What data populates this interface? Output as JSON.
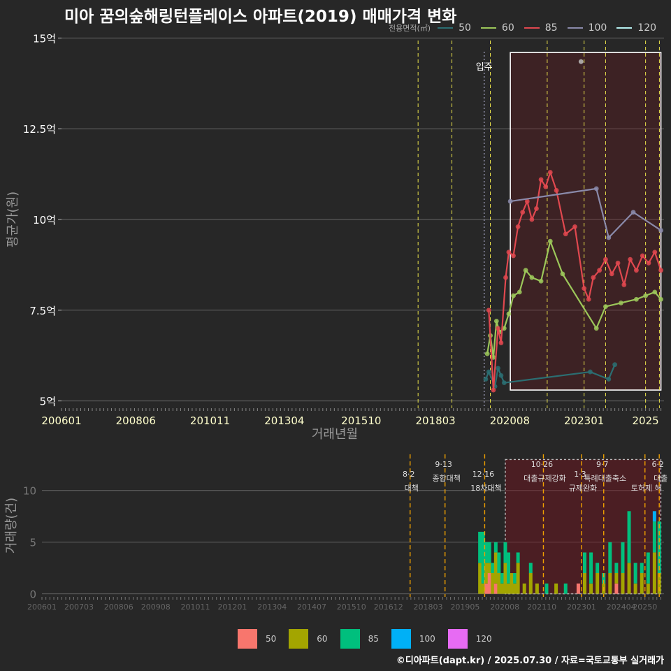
{
  "title": "미아 꿈의숲해링턴플레이스 아파트(2019) 매매가격 변화",
  "credit": "©디아파트(dapt.kr) / 2025.07.30 / 자료=국토교통부 실거래가",
  "legend_top": {
    "title": "전용면적(㎡)",
    "items": [
      {
        "label": "50",
        "color": "#2b6e72"
      },
      {
        "label": "60",
        "color": "#9cc75a"
      },
      {
        "label": "85",
        "color": "#e0484f"
      },
      {
        "label": "100",
        "color": "#8a8aaa"
      },
      {
        "label": "120",
        "color": "#b6f0f0"
      }
    ]
  },
  "legend_bottom": {
    "items": [
      {
        "label": "50",
        "color": "#f8766d"
      },
      {
        "label": "60",
        "color": "#a3a500"
      },
      {
        "label": "85",
        "color": "#00bf7d"
      },
      {
        "label": "100",
        "color": "#00b0f6"
      },
      {
        "label": "120",
        "color": "#e76bf3"
      }
    ]
  },
  "chart_data": [
    {
      "type": "line",
      "ylabel": "평균가(원)",
      "xlabel": "거래년월",
      "x_ticks": [
        "200601",
        "200806",
        "201011",
        "201304",
        "201510",
        "201803",
        "202008",
        "202301",
        "2025"
      ],
      "y_ticks": [
        "5억",
        "7.5억",
        "10억",
        "12.5억",
        "15억"
      ],
      "y_tick_values": [
        5,
        7.5,
        10,
        12.5,
        15
      ],
      "ylim": [
        4.8,
        15.2
      ],
      "xlim": [
        2006.0,
        2025.6
      ],
      "annotation": "입주",
      "move_in": 2019.75,
      "policy_lines": [
        2017.6,
        2018.7,
        2019.95,
        2021.8,
        2023.0,
        2023.7,
        2025.0,
        2025.45
      ],
      "highlight": {
        "x": [
          2020.6,
          2025.5
        ],
        "y": [
          5.3,
          14.6
        ]
      },
      "series": [
        {
          "name": "50",
          "color": "#2b6e72",
          "x": [
            2019.8,
            2019.9,
            2020.1,
            2020.2,
            2020.3,
            2020.4,
            2023.2,
            2023.8,
            2024.0
          ],
          "y": [
            5.6,
            5.8,
            5.4,
            5.9,
            5.7,
            5.5,
            5.8,
            5.6,
            6.0
          ]
        },
        {
          "name": "60",
          "color": "#9cc75a",
          "x": [
            2019.85,
            2019.95,
            2020.05,
            2020.15,
            2020.25,
            2020.4,
            2020.55,
            2020.7,
            2020.9,
            2021.1,
            2021.3,
            2021.6,
            2021.9,
            2022.3,
            2023.4,
            2023.7,
            2024.2,
            2024.7,
            2025.0,
            2025.3,
            2025.5
          ],
          "y": [
            6.3,
            6.8,
            6.2,
            7.2,
            6.9,
            7.0,
            7.4,
            7.9,
            8.0,
            8.6,
            8.4,
            8.3,
            9.4,
            8.5,
            7.0,
            7.6,
            7.7,
            7.8,
            7.9,
            8.0,
            7.8
          ]
        },
        {
          "name": "85",
          "color": "#e0484f",
          "x": [
            2019.9,
            2020.05,
            2020.2,
            2020.3,
            2020.45,
            2020.55,
            2020.7,
            2020.85,
            2021.0,
            2021.15,
            2021.3,
            2021.45,
            2021.6,
            2021.75,
            2021.9,
            2022.1,
            2022.4,
            2022.7,
            2023.0,
            2023.15,
            2023.3,
            2023.5,
            2023.7,
            2023.9,
            2024.1,
            2024.3,
            2024.5,
            2024.7,
            2024.9,
            2025.1,
            2025.3,
            2025.5
          ],
          "y": [
            7.5,
            5.3,
            7.0,
            6.6,
            8.4,
            9.1,
            9.0,
            9.8,
            10.2,
            10.5,
            10.0,
            10.3,
            11.1,
            10.9,
            11.3,
            10.8,
            9.6,
            9.8,
            8.1,
            7.8,
            8.4,
            8.6,
            8.9,
            8.5,
            8.8,
            8.2,
            8.9,
            8.6,
            9.0,
            8.8,
            9.1,
            8.6
          ]
        },
        {
          "name": "100",
          "color": "#8a8aaa",
          "x": [
            2020.6,
            2023.4,
            2023.8,
            2024.6,
            2025.5
          ],
          "y": [
            10.5,
            10.85,
            9.5,
            10.2,
            9.7
          ]
        },
        {
          "name": "120",
          "color": "#b6f0f0",
          "x": [
            2022.9
          ],
          "y": [
            14.35
          ]
        }
      ]
    },
    {
      "type": "bar",
      "ylabel": "거래량(건)",
      "x_ticks": [
        "200601",
        "200703",
        "200806",
        "200908",
        "201011",
        "201201",
        "201304",
        "201407",
        "201510",
        "201612",
        "201803",
        "201905",
        "202008",
        "202110",
        "202301",
        "202404",
        "20250"
      ],
      "y_ticks": [
        "0",
        "5",
        "10"
      ],
      "y_tick_values": [
        0,
        5,
        10
      ],
      "ylim": [
        -0.3,
        13.5
      ],
      "xlim": [
        2006.0,
        2025.6
      ],
      "policy_lines": [
        2017.6,
        2018.7,
        2019.95,
        2021.8,
        2023.0,
        2023.7,
        2025.0,
        2025.45
      ],
      "policy_labels": [
        {
          "date": "8·2",
          "name": "대책"
        },
        {
          "date": "9·13",
          "name": "종합대책"
        },
        {
          "date": "12·16",
          "name": "18차대책"
        },
        {
          "date": "10·26",
          "name": "대출규제강화"
        },
        {
          "date": "1·3",
          "name": "규제완화"
        },
        {
          "date": "9·7",
          "name": "특례대출축소"
        },
        {
          "date": "",
          "name": "토허제 해"
        },
        {
          "date": "6·2",
          "name": "대출"
        }
      ],
      "highlight": {
        "x": [
          2020.6,
          2025.5
        ],
        "y": [
          0,
          13
        ]
      },
      "series": [
        {
          "name": "50",
          "color": "#f8766d"
        },
        {
          "name": "60",
          "color": "#a3a500"
        },
        {
          "name": "85",
          "color": "#00bf7d"
        },
        {
          "name": "100",
          "color": "#00b0f6"
        },
        {
          "name": "120",
          "color": "#e76bf3"
        }
      ],
      "months": [
        2019.8,
        2019.9,
        2020.0,
        2020.1,
        2020.2,
        2020.3,
        2020.4,
        2020.5,
        2020.6,
        2020.7,
        2020.8,
        2020.9,
        2021.0,
        2021.2,
        2021.4,
        2021.6,
        2021.9,
        2022.2,
        2022.5,
        2022.9,
        2023.1,
        2023.3,
        2023.5,
        2023.7,
        2023.9,
        2024.1,
        2024.3,
        2024.5,
        2024.7,
        2024.9,
        2025.1,
        2025.3,
        2025.45
      ],
      "stacks": [
        [
          0,
          3,
          3,
          0,
          0
        ],
        [
          0,
          1,
          5,
          0,
          0
        ],
        [
          1,
          2,
          2,
          0,
          0
        ],
        [
          2,
          1,
          2,
          0,
          0
        ],
        [
          0,
          2,
          1,
          0,
          0
        ],
        [
          1,
          3,
          1,
          0,
          0
        ],
        [
          0,
          2,
          2,
          0,
          0
        ],
        [
          0,
          1,
          1,
          0,
          0
        ],
        [
          0,
          3,
          2,
          0,
          0
        ],
        [
          0,
          1,
          3,
          0,
          0
        ],
        [
          0,
          2,
          0,
          0,
          0
        ],
        [
          0,
          1,
          1,
          0,
          0
        ],
        [
          0,
          3,
          1,
          0,
          0
        ],
        [
          0,
          1,
          0,
          0,
          0
        ],
        [
          0,
          2,
          1,
          0,
          0
        ],
        [
          0,
          1,
          0,
          0,
          0
        ],
        [
          0,
          0,
          1,
          0,
          0
        ],
        [
          0,
          1,
          0,
          0,
          0
        ],
        [
          0,
          0,
          1,
          0,
          0
        ],
        [
          1,
          0,
          0,
          0,
          0
        ],
        [
          0,
          2,
          2,
          0,
          0
        ],
        [
          0,
          1,
          3,
          0,
          0
        ],
        [
          0,
          2,
          1,
          0,
          0
        ],
        [
          0,
          1,
          1,
          0,
          0
        ],
        [
          0,
          2,
          3,
          0,
          0
        ],
        [
          1,
          1,
          1,
          0,
          0
        ],
        [
          0,
          2,
          3,
          0,
          0
        ],
        [
          0,
          3,
          5,
          0,
          0
        ],
        [
          0,
          1,
          2,
          0,
          0
        ],
        [
          0,
          2,
          1,
          0,
          0
        ],
        [
          0,
          1,
          3,
          0,
          0
        ],
        [
          0,
          4,
          3,
          1,
          0
        ],
        [
          0,
          2,
          5,
          0,
          0
        ]
      ]
    }
  ]
}
